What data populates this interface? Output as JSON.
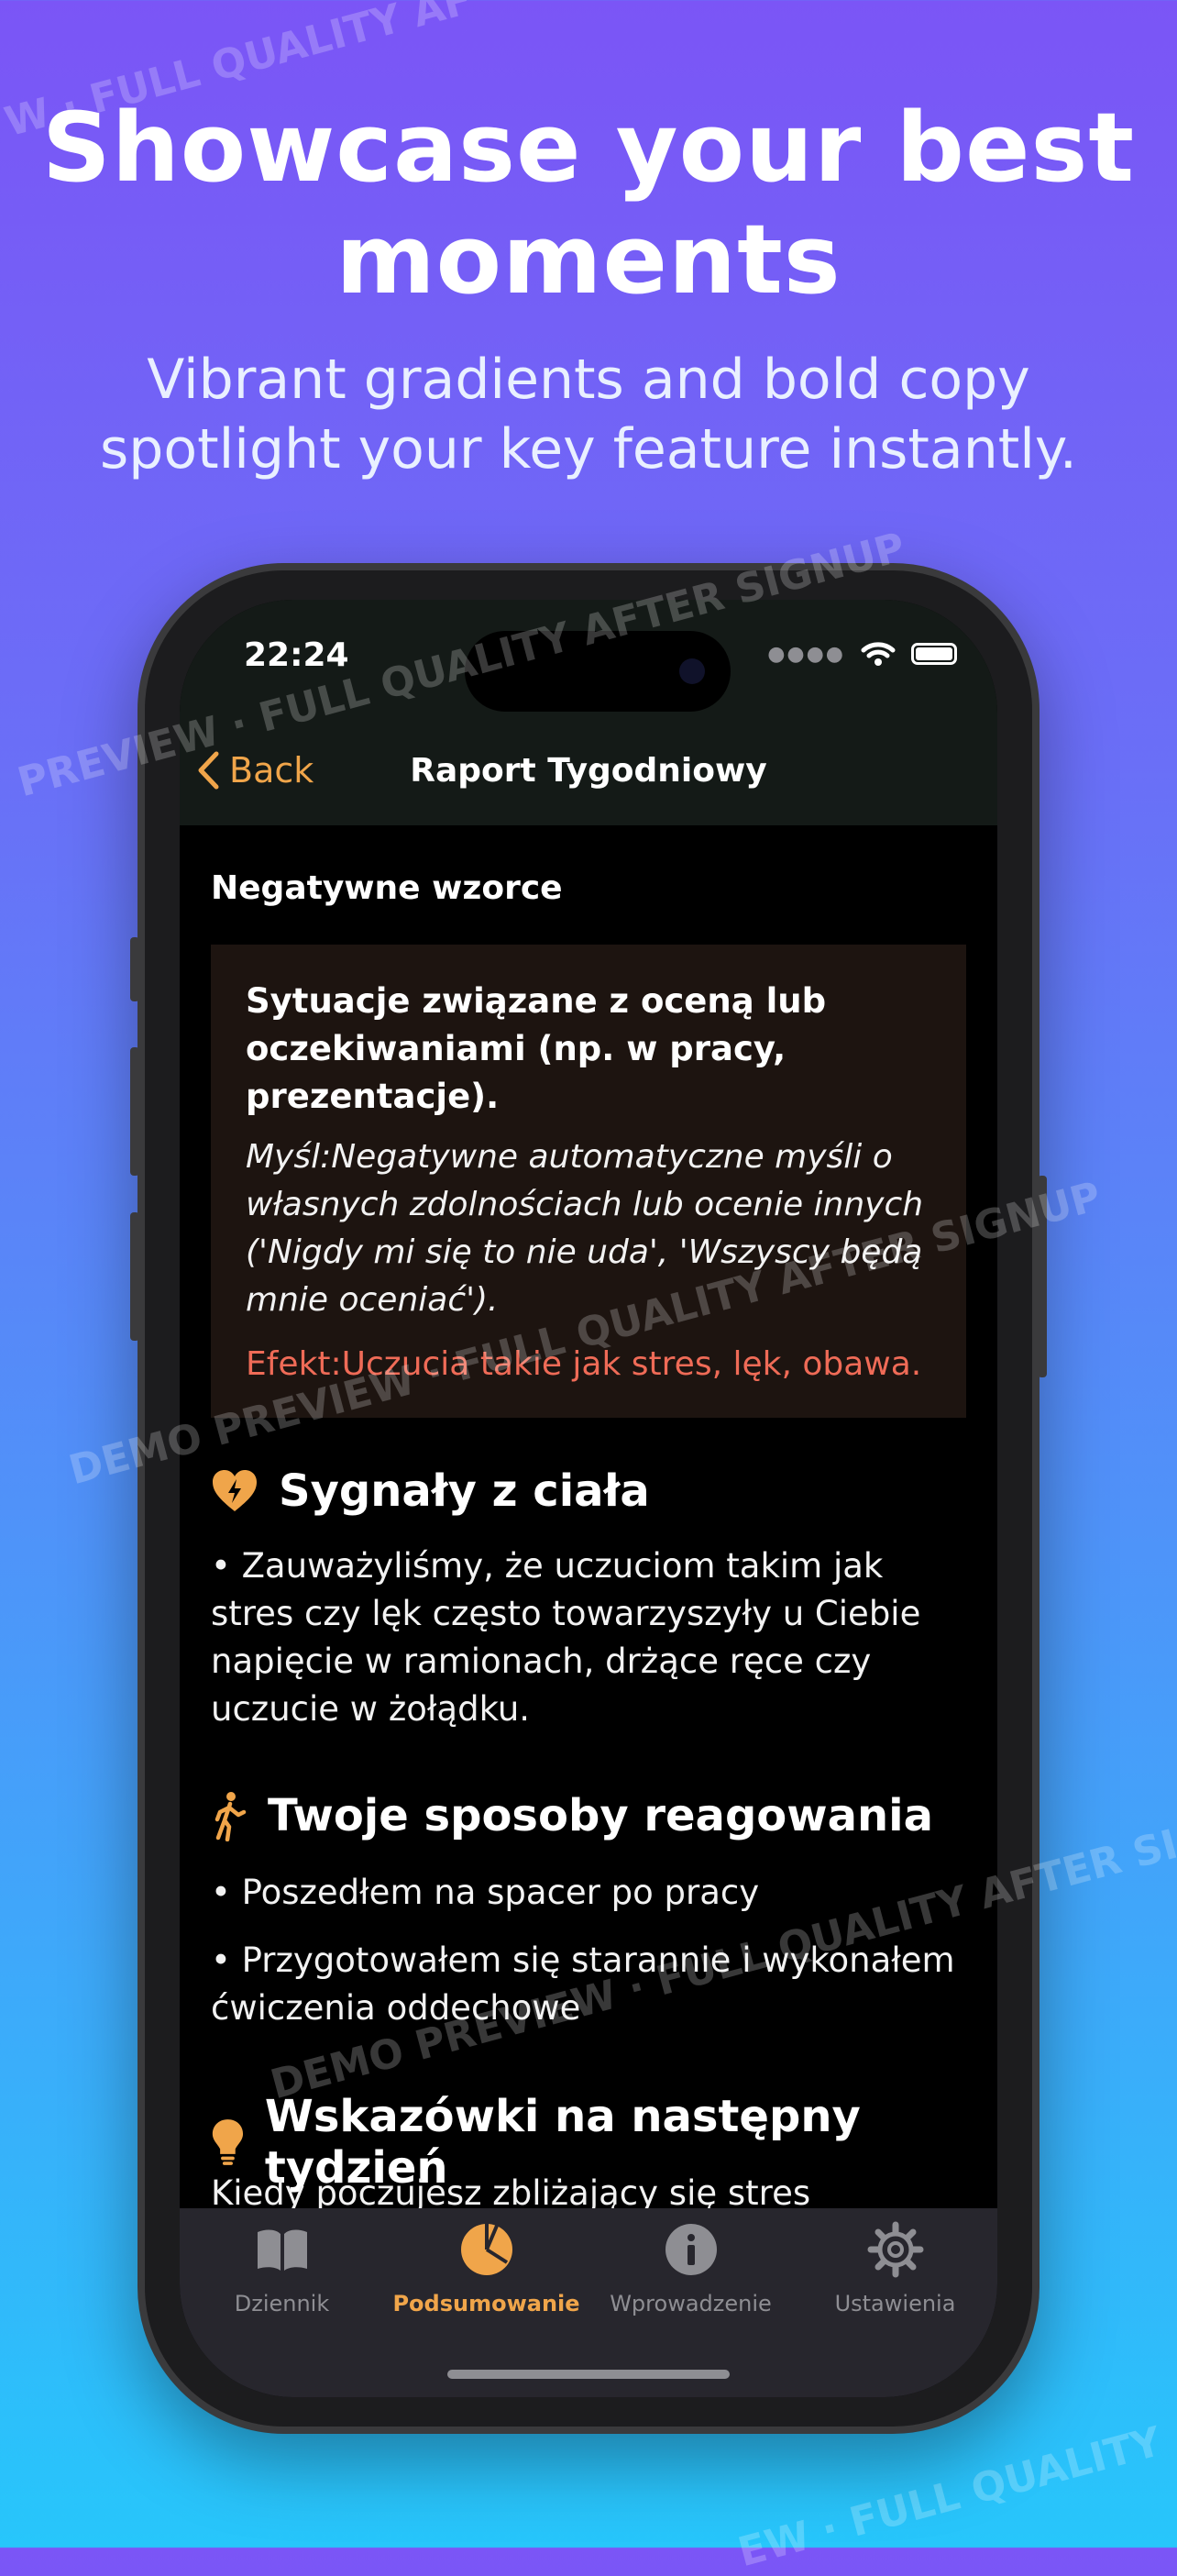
{
  "promo": {
    "headline": "Showcase your best moments",
    "subline": "Vibrant gradients and bold copy spotlight your key feature instantly."
  },
  "watermarks": {
    "w1": "W · FULL QUALITY AF",
    "w2": "PREVIEW · FULL QUALITY AFTER SIGNUP",
    "w3": "DEMO PREVIEW · FULL QUALITY AFTER SIGNUP",
    "w4": "DEMO PREVIEW · FULL QUALITY AFTER SI",
    "w5": "EW · FULL QUALITY"
  },
  "status": {
    "time": "22:24"
  },
  "nav": {
    "back_label": "Back",
    "title": "Raport Tygodniowy"
  },
  "report": {
    "negative_patterns": {
      "title": "Negatywne wzorce",
      "situation": "Sytuacje związane z oceną lub oczekiwaniami (np. w pracy, prezentacje).",
      "thought": "Myśl:Negatywne automatyczne myśli o własnych zdolnościach lub ocenie innych ('Nigdy mi się to nie uda', 'Wszyscy będą mnie oceniać').",
      "effect": "Efekt:Uczucia takie jak stres, lęk, obawa."
    },
    "body_signals": {
      "icon": "heart-bolt-icon",
      "title": "Sygnały z ciała",
      "text": "• Zauważyliśmy, że uczuciom takim jak stres czy lęk często towarzyszyły u Ciebie napięcie w ramionach, drżące ręce czy uczucie w żołądku."
    },
    "coping": {
      "icon": "walking-icon",
      "title": "Twoje sposoby reagowania",
      "items": [
        "• Poszedłem na spacer po pracy",
        "• Przygotowałem się starannie i wykonałem ćwiczenia oddechowe"
      ]
    },
    "tips": {
      "icon": "lightbulb-icon",
      "title": "Wskazówki na następny tydzień",
      "text": "Kiedy poczujesz zbliżający się stres związany z oceną, spróbuj zatrzymać się i zadać sobie"
    }
  },
  "tabs": [
    {
      "label": "Dziennik",
      "icon": "book-icon"
    },
    {
      "label": "Podsumowanie",
      "icon": "pie-chart-icon",
      "active": true
    },
    {
      "label": "Wprowadzenie",
      "icon": "info-icon"
    },
    {
      "label": "Ustawienia",
      "icon": "gear-icon"
    }
  ],
  "colors": {
    "accent": "#f0a54a",
    "effect_red": "#ef6b57",
    "card_bg": "#1d1410",
    "tabbar_bg": "#27262d"
  }
}
